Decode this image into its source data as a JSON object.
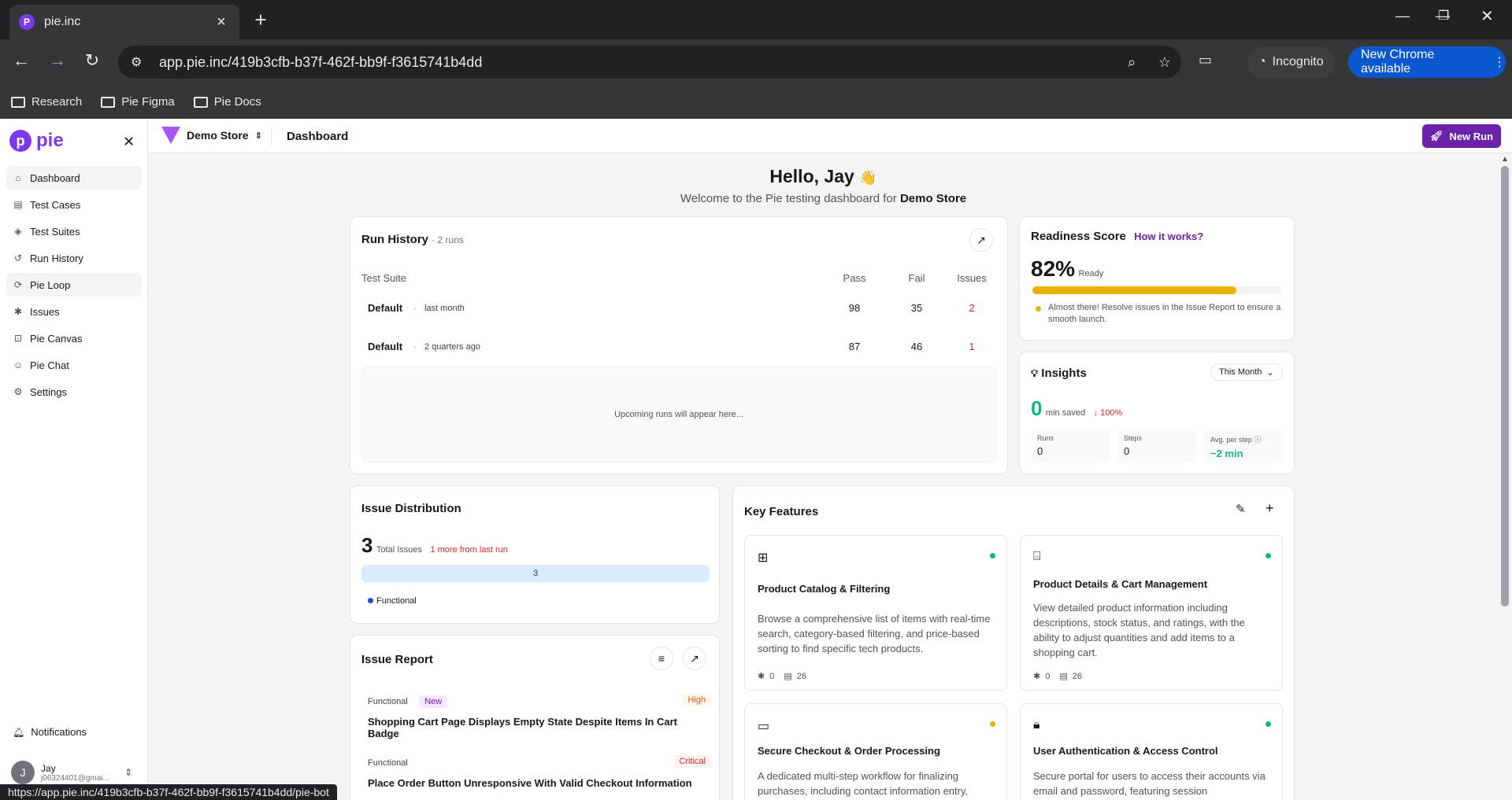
{
  "browser": {
    "tab_title": "pie.inc",
    "favicon_letter": "P",
    "url": "app.pie.inc/419b3cfb-b37f-462f-bb9f-f3615741b4dd",
    "incognito_label": "Incognito",
    "update_label": "New Chrome available",
    "bookmarks": [
      "Research",
      "Pie Figma",
      "Pie Docs"
    ],
    "status_url": "https://app.pie.inc/419b3cfb-b37f-462f-bb9f-f3615741b4dd/pie-bot"
  },
  "sidebar": {
    "logo_text": "pie",
    "logo_mark": "p",
    "items": [
      {
        "label": "Dashboard",
        "icon": "dashboard-icon",
        "active": true
      },
      {
        "label": "Test Cases",
        "icon": "clipboard-icon",
        "active": false
      },
      {
        "label": "Test Suites",
        "icon": "layers-icon",
        "active": false
      },
      {
        "label": "Run History",
        "icon": "history-icon",
        "active": false
      },
      {
        "label": "Pie Loop",
        "icon": "loop-icon",
        "active": true
      },
      {
        "label": "Issues",
        "icon": "bug-icon",
        "active": false
      },
      {
        "label": "Pie Canvas",
        "icon": "canvas-icon",
        "active": false
      },
      {
        "label": "Pie Chat",
        "icon": "bot-icon",
        "active": false
      },
      {
        "label": "Settings",
        "icon": "gear-icon",
        "active": false
      }
    ],
    "notifications_label": "Notifications",
    "user": {
      "initial": "J",
      "name": "Jay",
      "email": "j06324401@gmai..."
    }
  },
  "topbar": {
    "store_name": "Demo Store",
    "breadcrumb": "Dashboard",
    "new_run_label": "New Run"
  },
  "greeting": {
    "title": "Hello, Jay",
    "emoji": "👋",
    "subtitle_prefix": "Welcome to the Pie testing dashboard for",
    "store": "Demo Store"
  },
  "run_history": {
    "title": "Run History",
    "count": "· 2 runs",
    "headers": {
      "suite": "Test Suite",
      "pass": "Pass",
      "fail": "Fail",
      "issues": "Issues"
    },
    "rows": [
      {
        "suite": "Default",
        "when": "last month",
        "pass": "98",
        "fail": "35",
        "issues": "2"
      },
      {
        "suite": "Default",
        "when": "2 quarters ago",
        "pass": "87",
        "fail": "46",
        "issues": "1"
      }
    ],
    "upcoming": "Upcoming runs will appear here..."
  },
  "readiness": {
    "title": "Readiness Score",
    "link": "How it works?",
    "score": "82%",
    "state": "Ready",
    "progress": 0.82,
    "note": "Almost there! Resolve issues in the Issue Report to ensure a smooth launch."
  },
  "insights": {
    "title": "Insights",
    "period": "This Month",
    "minutes": "0",
    "minutes_label": "min saved",
    "delta": "↓ 100%",
    "stats": [
      {
        "label": "Runs",
        "value": "0"
      },
      {
        "label": "Steps",
        "value": "0"
      },
      {
        "label": "Avg. per step",
        "value": "~2 min"
      }
    ]
  },
  "issue_distribution": {
    "title": "Issue Distribution",
    "total": "3",
    "total_label": "Total Issues",
    "delta": "1 more from last run",
    "bar_value": "3",
    "legend": "Functional"
  },
  "issue_report": {
    "title": "Issue Report",
    "items": [
      {
        "category": "Functional",
        "badge": "New",
        "severity": "High",
        "title": "Shopping Cart Page Displays Empty State Despite Items In Cart Badge"
      },
      {
        "category": "Functional",
        "badge": "",
        "severity": "Critical",
        "title": "Place Order Button Unresponsive With Valid Checkout Information"
      }
    ]
  },
  "key_features": {
    "title": "Key Features",
    "items": [
      {
        "title": "Product Catalog & Filtering",
        "desc": "Browse a comprehensive list of items with real-time search, category-based filtering, and price-based sorting to find specific tech products.",
        "bugs": "0",
        "tests": "26",
        "status_color": "#10b981",
        "icon": "grid-icon"
      },
      {
        "title": "Product Details & Cart Management",
        "desc": "View detailed product information including descriptions, stock status, and ratings, with the ability to adjust quantities and add items to a shopping cart.",
        "bugs": "0",
        "tests": "26",
        "status_color": "#10b981",
        "icon": "briefcase-icon"
      },
      {
        "title": "Secure Checkout & Order Processing",
        "desc": "A dedicated multi-step workflow for finalizing purchases, including contact information entry,",
        "bugs": "",
        "tests": "",
        "status_color": "#eab308",
        "icon": "monitor-icon"
      },
      {
        "title": "User Authentication & Access Control",
        "desc": "Secure portal for users to access their accounts via email and password, featuring session management",
        "bugs": "",
        "tests": "",
        "status_color": "#10b981",
        "icon": "lock-icon"
      }
    ]
  }
}
